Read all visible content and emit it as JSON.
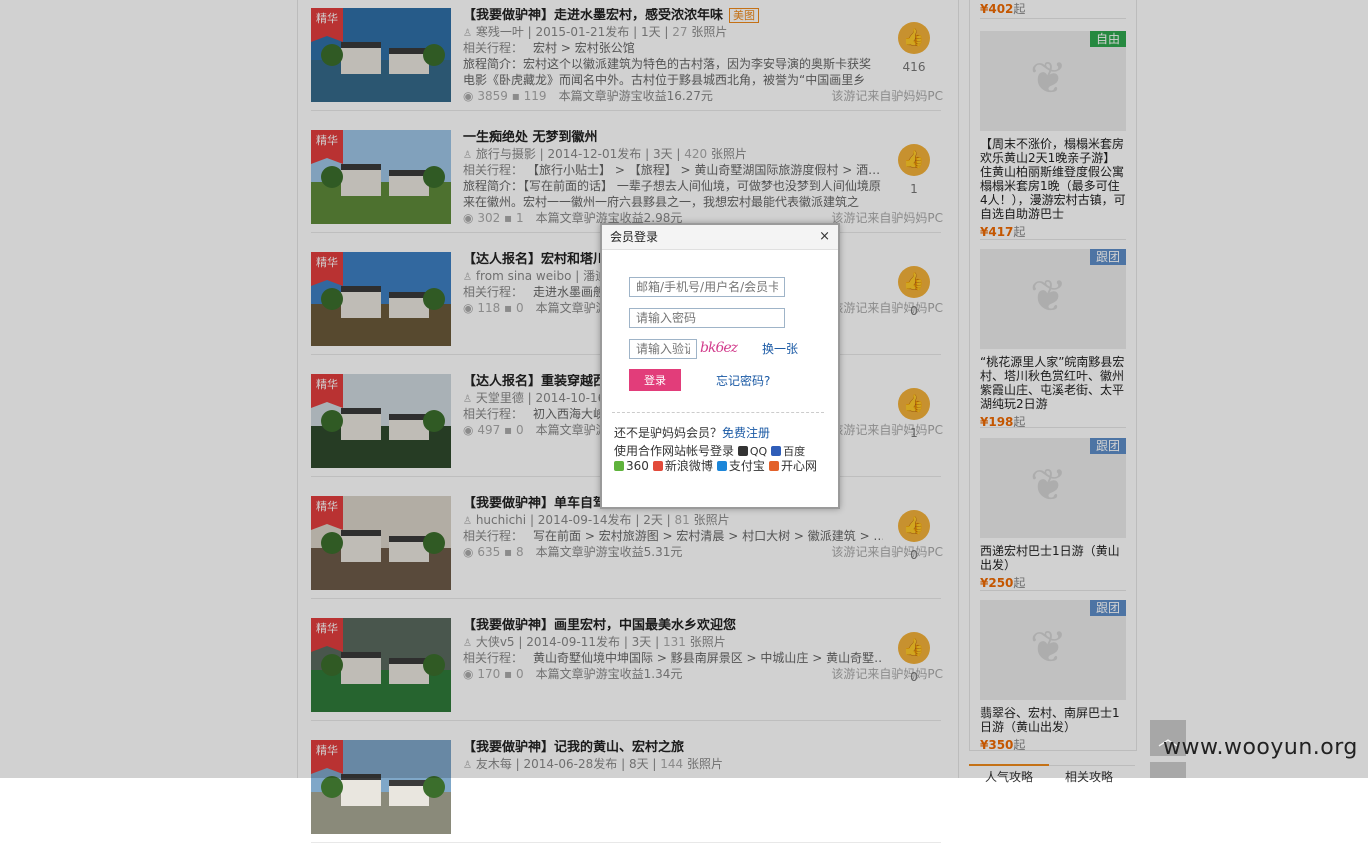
{
  "notes": [
    {
      "badge": "精华",
      "title": "【我要做驴神】走进水墨宏村，感受浓浓年味",
      "tag": "美图",
      "author": "寒残一叶",
      "date": "2015-01-21发布",
      "days": "1天",
      "photos_num": "27",
      "photos_label": "张照片",
      "route_label": "相关行程：",
      "route": "宏村 > 宏村张公馆",
      "intro_label": "旅程简介：",
      "intro": "宏村这个以徽派建筑为特色的古村落，因为李安导演的奥斯卡获奖电影《卧虎藏龙》而闻名中外。古村位于黟县城西北角，被誉为“中国画里乡",
      "views": "3859",
      "comments": "119",
      "earn": "本篇文章驴游宝收益16.27元",
      "from": "该游记来自驴妈妈PC",
      "likes": "416",
      "palette": {
        "sky": "#2f6fa8",
        "ground": "#356a8a"
      }
    },
    {
      "badge": "精华",
      "title": "一生痴绝处 无梦到徽州",
      "tag": "",
      "author": "旅行与摄影",
      "date": "2014-12-01发布",
      "days": "3天",
      "photos_num": "420",
      "photos_label": "张照片",
      "route_label": "相关行程：",
      "route": "【旅行小贴士】 > 【旅程】 > 黄山奇墅湖国际旅游度假村 > 酒…",
      "intro_label": "旅程简介：",
      "intro": "【写在前面的话】 一辈子想去人间仙境，可做梦也没梦到人间仙境原来在徽州。宏村一一徽州一府六县黟县之一，我想宏村最能代表徽派建筑之",
      "views": "302",
      "comments": "1",
      "earn": "本篇文章驴游宝收益2.98元",
      "from": "该游记来自驴妈妈PC",
      "likes": "1",
      "palette": {
        "sky": "#9ec5e6",
        "ground": "#5e8a3a"
      }
    },
    {
      "badge": "精华",
      "title": "【达人报名】宏村和塔川",
      "tag": "",
      "author": "from sina weibo",
      "date": "潘迪",
      "days": "",
      "photos_num": "",
      "photos_label": "张照片",
      "route_label": "相关行程：",
      "route": "走进水墨画般… 菜 > …",
      "intro_label": "",
      "intro": "",
      "views": "118",
      "comments": "0",
      "earn": "本篇文章驴游宝收",
      "from": "该游记来自驴妈妈PC",
      "likes": "0",
      "palette": {
        "sky": "#3d7fc2",
        "ground": "#6b5a3a"
      }
    },
    {
      "badge": "精华",
      "title": "【达人报名】重装穿越西",
      "tag": "",
      "author": "天堂里德",
      "date": "2014-10-16",
      "days": "",
      "photos_num": "",
      "photos_label": "张照片",
      "route_label": "相关行程：",
      "route": "初入西海大峡… 一日 > …",
      "intro_label": "",
      "intro": "",
      "views": "497",
      "comments": "0",
      "earn": "本篇文章驴游宝",
      "from": "该游记来自驴妈妈PC",
      "likes": "1",
      "palette": {
        "sky": "#cfd8de",
        "ground": "#2f4a2c"
      }
    },
    {
      "badge": "精华",
      "title": "【我要做驴神】单车自驾：黟县宏村，东美画卷",
      "tag": "",
      "author": "huchichi",
      "date": "2014-09-14发布",
      "days": "2天",
      "photos_num": "81",
      "photos_label": "张照片",
      "route_label": "相关行程：",
      "route": "写在前面 > 宏村旅游图 > 宏村清晨 > 村口大树 > 徽派建筑 > …",
      "intro_label": "",
      "intro": "",
      "views": "635",
      "comments": "8",
      "earn": "本篇文章驴游宝收益5.31元",
      "from": "该游记来自驴妈妈PC",
      "likes": "0",
      "palette": {
        "sky": "#d9d4c8",
        "ground": "#6d5b48"
      }
    },
    {
      "badge": "精华",
      "title": "【我要做驴神】画里宏村，中国最美水乡欢迎您",
      "tag": "",
      "author": "大侠v5",
      "date": "2014-09-11发布",
      "days": "3天",
      "photos_num": "131",
      "photos_label": "张照片",
      "route_label": "相关行程：",
      "route": "黄山奇墅仙境中坤国际 > 黟县南屏景区 > 中城山庄 > 黄山奇墅…",
      "intro_label": "",
      "intro": "",
      "views": "170",
      "comments": "0",
      "earn": "本篇文章驴游宝收益1.34元",
      "from": "该游记来自驴妈妈PC",
      "likes": "0",
      "palette": {
        "sky": "#5a6a5e",
        "ground": "#2f7a3a"
      }
    },
    {
      "badge": "精华",
      "title": "【我要做驴神】记我的黄山、宏村之旅",
      "tag": "",
      "author": "友木每",
      "date": "2014-06-28发布",
      "days": "8天",
      "photos_num": "144",
      "photos_label": "张照片",
      "route_label": "",
      "route": "",
      "intro_label": "",
      "intro": "",
      "views": "",
      "comments": "",
      "earn": "",
      "from": "",
      "likes": "",
      "palette": {
        "sky": "#7fa7c8",
        "ground": "#8a8a7a"
      }
    }
  ],
  "sidebar": {
    "top_price": "¥402",
    "top_price_suffix": "起",
    "products": [
      {
        "tag": "自由",
        "tag_color": "#2fa84f",
        "name": "【周末不涨价，榻榻米套房欢乐黄山2天1晚亲子游】住黄山柏丽斯维登度假公寓榻榻米套房1晚（最多可住4人！），漫游宏村古镇，可自选自助游巴士",
        "price": "¥417",
        "suffix": "起"
      },
      {
        "tag": "跟团",
        "tag_color": "#5f8ec9",
        "name": "“桃花源里人家”皖南黟县宏村、塔川秋色赏红叶、徽州紫霞山庄、屯溪老街、太平湖纯玩2日游",
        "price": "¥198",
        "suffix": "起"
      },
      {
        "tag": "跟团",
        "tag_color": "#5f8ec9",
        "name": "西递宏村巴士1日游（黄山出发）",
        "price": "¥250",
        "suffix": "起"
      },
      {
        "tag": "跟团",
        "tag_color": "#5f8ec9",
        "name": "翡翠谷、宏村、南屏巴士1日游（黄山出发）",
        "price": "¥350",
        "suffix": "起"
      }
    ],
    "tabs": [
      "人气攻略",
      "相关攻略"
    ]
  },
  "login": {
    "title": "会员登录",
    "close": "×",
    "account_placeholder": "邮箱/手机号/用户名/会员卡",
    "password_placeholder": "请输入密码",
    "captcha_placeholder": "请输入验证码",
    "captcha_text": "bk6ez",
    "refresh": "换一张",
    "submit": "登录",
    "forgot": "忘记密码?",
    "not_member": "还不是驴妈妈会员？",
    "register": "免费注册",
    "partner_intro": "使用合作网站帐号登录",
    "partners": [
      {
        "name": "QQ",
        "color": "#333"
      },
      {
        "name": "百度",
        "color": "#2f5db8"
      },
      {
        "name": "360",
        "color": "#5fb33c"
      },
      {
        "name": "新浪微博",
        "color": "#e24a3a"
      },
      {
        "name": "支付宝",
        "color": "#1c86d9"
      },
      {
        "name": "开心网",
        "color": "#e3612a"
      }
    ]
  },
  "watermark": "www.wooyun.org",
  "back_to_top_icon": "chevron-up-icon"
}
